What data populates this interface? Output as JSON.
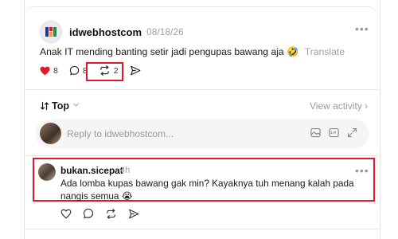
{
  "post": {
    "username": "idwebhostcom",
    "date": "08/18/26",
    "text": "Anak IT mending banting setir jadi pengupas bawang aja",
    "emoji": "🤣",
    "translate_label": "Translate",
    "likes": "8",
    "comments": "8",
    "reposts": "2"
  },
  "sort": {
    "label": "Top",
    "icon": "sort-arrows-icon"
  },
  "view_activity": "View activity",
  "reply": {
    "placeholder": "Reply to idwebhostcom..."
  },
  "comment": {
    "username": "bukan.sicepat",
    "time": "4h",
    "text": "Ada lomba kupas bawang gak min? Kayaknya tuh menang kalah pada nangis semua",
    "emoji": "😭"
  },
  "colors": {
    "highlight": "#e1182b",
    "like": "#e1182b"
  }
}
